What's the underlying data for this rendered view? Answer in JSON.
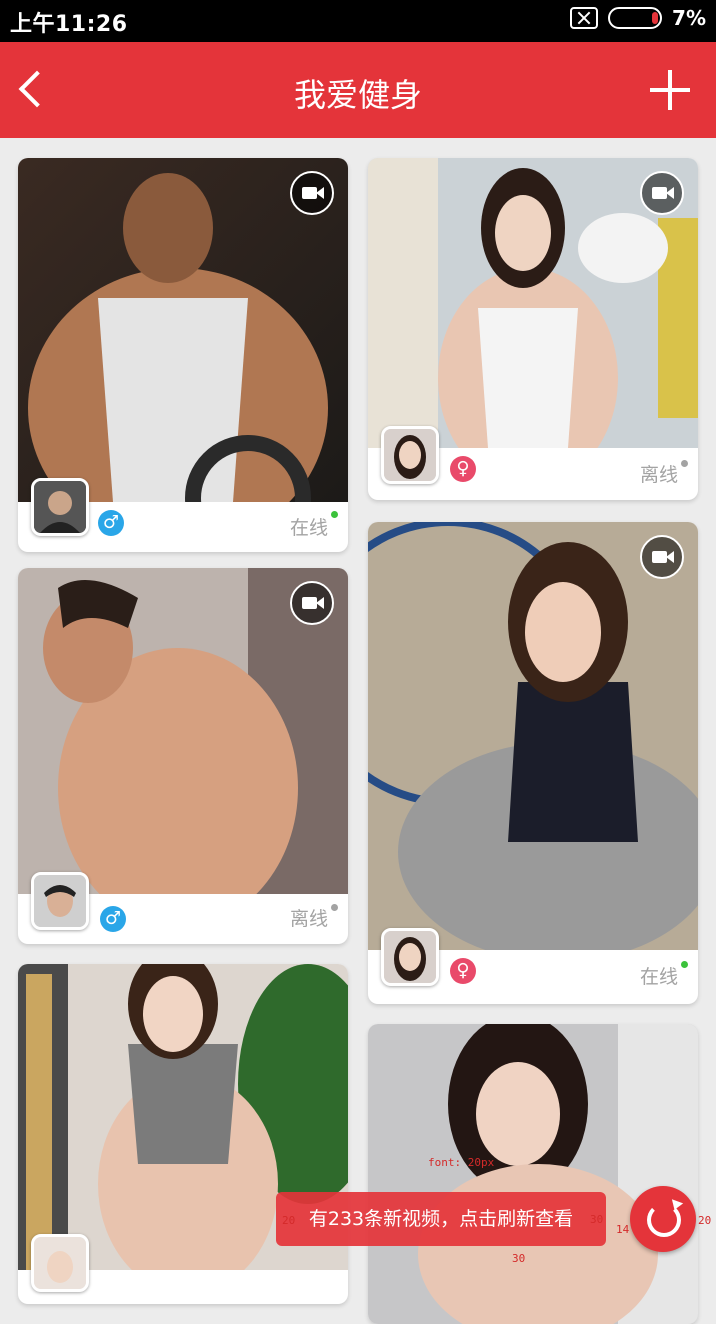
{
  "status_bar": {
    "time": "上午11:26",
    "battery": "7%"
  },
  "header": {
    "title": "我爱健身"
  },
  "feed": [
    {
      "gender": "♂",
      "status": "在线",
      "online": true
    },
    {
      "gender": "♀",
      "status": "离线",
      "online": false
    },
    {
      "gender": "♂",
      "status": "离线",
      "online": false
    },
    {
      "gender": "♀",
      "status": "在线",
      "online": true
    }
  ],
  "toast": {
    "text": "有233条新视频，点击刷新查看"
  },
  "annotations": {
    "font": "font: 20px",
    "left_pad": "20",
    "right_pad": "30",
    "bottom_pad": "30",
    "gap": "14",
    "right_margin": "20"
  },
  "colors": {
    "brand": "#e4343a",
    "male": "#2aa6e8",
    "female": "#e94a6a",
    "online": "#3bc23b"
  }
}
